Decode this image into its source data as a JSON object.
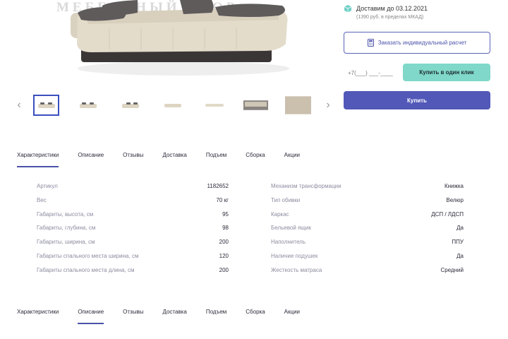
{
  "watermark": "МЕБЕЛЬНЫЙ ДВОР",
  "delivery": {
    "title": "Доставим до 03.12.2021",
    "note": "(1390 руб. в пределах МКАД)"
  },
  "buttons": {
    "calc": "Заказать индивидуальный расчет",
    "one_click": "Купить в один клик",
    "buy": "Купить"
  },
  "phone": {
    "value": "+7(___) ___-____"
  },
  "thumbnails": {
    "prev_icon": "chevron-left-icon",
    "next_icon": "chevron-right-icon",
    "count": 7
  },
  "tabs": [
    "Характеристики",
    "Описание",
    "Отзывы",
    "Доставка",
    "Подъем",
    "Сборка",
    "Акции"
  ],
  "specs_left": [
    {
      "label": "Артикул",
      "value": "1182652"
    },
    {
      "label": "Вес",
      "value": "70 кг"
    },
    {
      "label": "Габариты, высота, см",
      "value": "95"
    },
    {
      "label": "Габариты, глубина, см",
      "value": "98"
    },
    {
      "label": "Габариты, ширина, см",
      "value": "200"
    },
    {
      "label": "Габариты спального места ширина, см",
      "value": "120"
    },
    {
      "label": "Габариты спального места длина, см",
      "value": "200"
    }
  ],
  "specs_right": [
    {
      "label": "Механизм трансформации",
      "value": "Книжка"
    },
    {
      "label": "Тип обивки",
      "value": "Велюр"
    },
    {
      "label": "Каркас",
      "value": "ДСП / ЛДСП"
    },
    {
      "label": "Бельевой ящик",
      "value": "Да"
    },
    {
      "label": "Наполнитель",
      "value": "ППУ"
    },
    {
      "label": "Наличие подушек",
      "value": "Да"
    },
    {
      "label": "Жесткость матраса",
      "value": "Средний"
    }
  ],
  "colors": {
    "accent": "#5158b8",
    "one_click": "#7fd8c9",
    "upholstery": "#e3dccb",
    "pillow": "#5f5b5b"
  }
}
